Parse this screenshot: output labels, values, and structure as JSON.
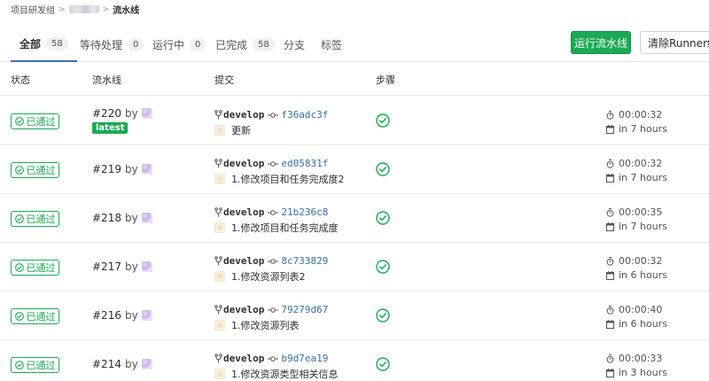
{
  "breadcrumb": {
    "group": "项目研发组",
    "sep": ">",
    "current": "流水线"
  },
  "tabs": [
    {
      "label": "全部",
      "count": "58"
    },
    {
      "label": "等待处理",
      "count": "0"
    },
    {
      "label": "运行中",
      "count": "0"
    },
    {
      "label": "已完成",
      "count": "58"
    },
    {
      "label": "分支"
    },
    {
      "label": "标签"
    }
  ],
  "actions": {
    "run": "运行流水线",
    "clear": "清除Runner缓存"
  },
  "headers": {
    "status": "状态",
    "pipeline": "流水线",
    "commit": "提交",
    "stages": "步骤"
  },
  "colors": {
    "success": "#1aaa55",
    "link": "#3a6fb0"
  },
  "rows": [
    {
      "status": "已通过",
      "id": "#220",
      "by": "by",
      "badge": "latest",
      "branch": "develop",
      "sha": "f36adc3f",
      "message": "更新",
      "duration": "00:00:32",
      "finished": "in 7 hours"
    },
    {
      "status": "已通过",
      "id": "#219",
      "by": "by",
      "branch": "develop",
      "sha": "ed05831f",
      "message": "1.修改项目和任务完成度2",
      "duration": "00:00:32",
      "finished": "in 7 hours"
    },
    {
      "status": "已通过",
      "id": "#218",
      "by": "by",
      "branch": "develop",
      "sha": "21b236c8",
      "message": "1.修改项目和任务完成度",
      "duration": "00:00:35",
      "finished": "in 7 hours"
    },
    {
      "status": "已通过",
      "id": "#217",
      "by": "by",
      "branch": "develop",
      "sha": "8c733829",
      "message": "1.修改资源列表2",
      "duration": "00:00:32",
      "finished": "in 6 hours"
    },
    {
      "status": "已通过",
      "id": "#216",
      "by": "by",
      "branch": "develop",
      "sha": "79279d67",
      "message": "1.修改资源列表",
      "duration": "00:00:40",
      "finished": "in 6 hours"
    },
    {
      "status": "已通过",
      "id": "#214",
      "by": "by",
      "branch": "develop",
      "sha": "b9d7ea19",
      "message": "1.修改资源类型相关信息",
      "duration": "00:00:33",
      "finished": "in 3 hours"
    }
  ]
}
